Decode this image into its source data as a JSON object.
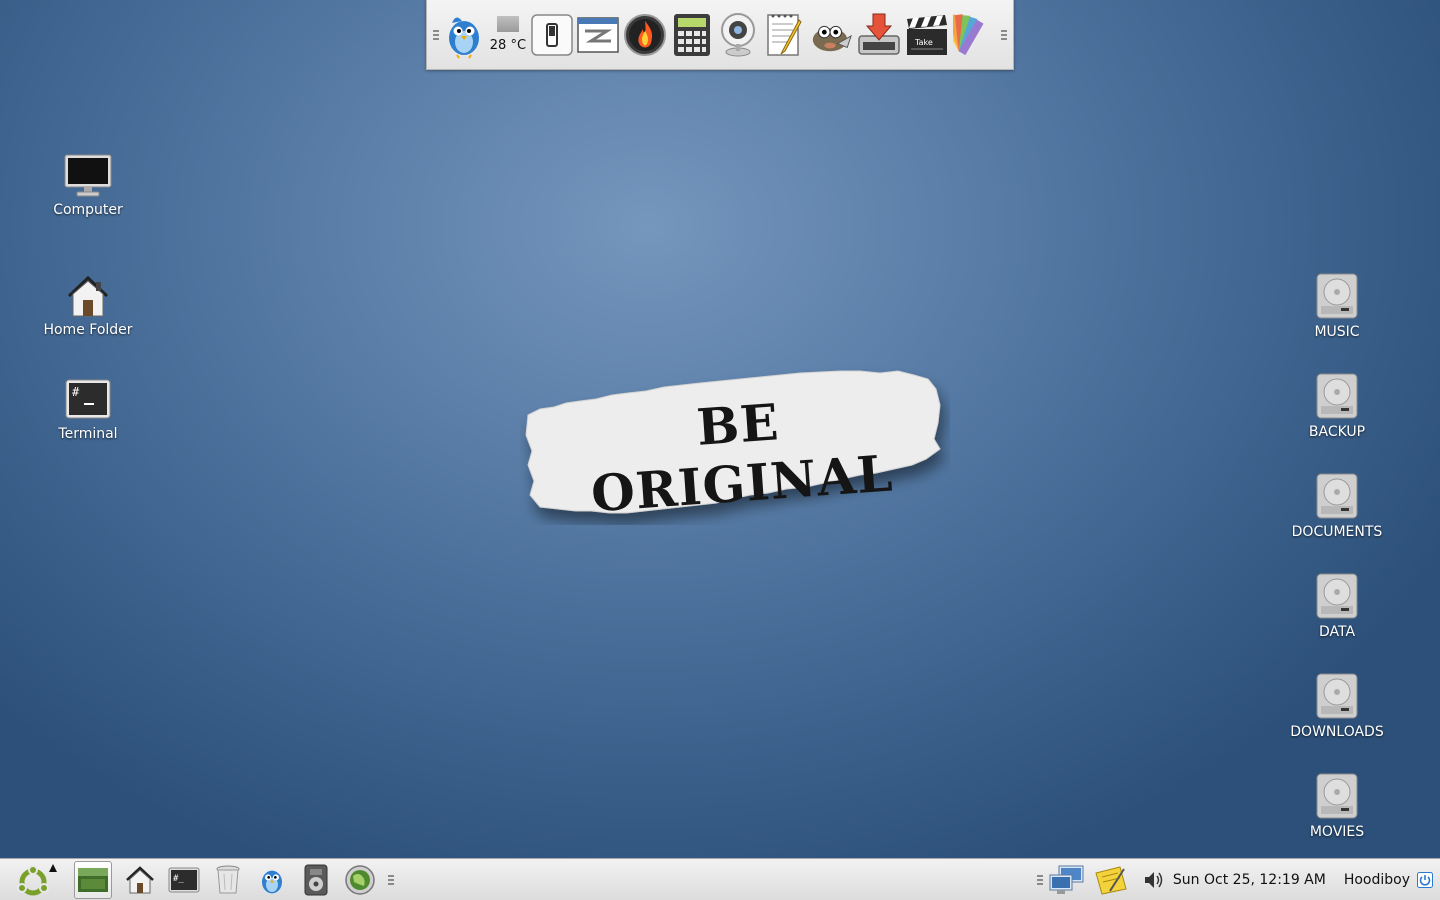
{
  "top_panel": {
    "temperature": "28 °C",
    "launchers": [
      "twitter-bird-icon",
      "temperature-widget",
      "switch-icon",
      "window-switcher-icon",
      "firewall-icon",
      "calculator-icon",
      "webcam-icon",
      "text-editor-icon",
      "gimp-icon",
      "download-manager-icon",
      "video-editor-icon",
      "color-palette-icon"
    ]
  },
  "desktop": {
    "left_icons": [
      {
        "label": "Computer",
        "icon": "monitor-icon"
      },
      {
        "label": "Home Folder",
        "icon": "home-icon"
      },
      {
        "label": "Terminal",
        "icon": "terminal-icon"
      }
    ],
    "right_icons": [
      {
        "label": "MUSIC",
        "icon": "hard-drive-icon"
      },
      {
        "label": "BACKUP",
        "icon": "hard-drive-icon"
      },
      {
        "label": "DOCUMENTS",
        "icon": "hard-drive-icon"
      },
      {
        "label": "DATA",
        "icon": "hard-drive-icon"
      },
      {
        "label": "DOWNLOADS",
        "icon": "hard-drive-icon"
      },
      {
        "label": "MOVIES",
        "icon": "hard-drive-icon"
      }
    ],
    "wallpaper_text": "BE ORIGINAL"
  },
  "taskbar": {
    "items": [
      "ubuntu-menu-icon",
      "show-desktop-icon",
      "home-icon",
      "terminal-icon",
      "trash-icon",
      "twitter-bird-icon",
      "music-player-icon",
      "browser-icon"
    ],
    "clock": "Sun Oct 25, 12:19 AM",
    "user": "Hoodiboy"
  },
  "colors": {
    "desktop_bg": "#4f769f",
    "panel_bg": "#e6e6e6",
    "accent": "#2a7bd0"
  }
}
